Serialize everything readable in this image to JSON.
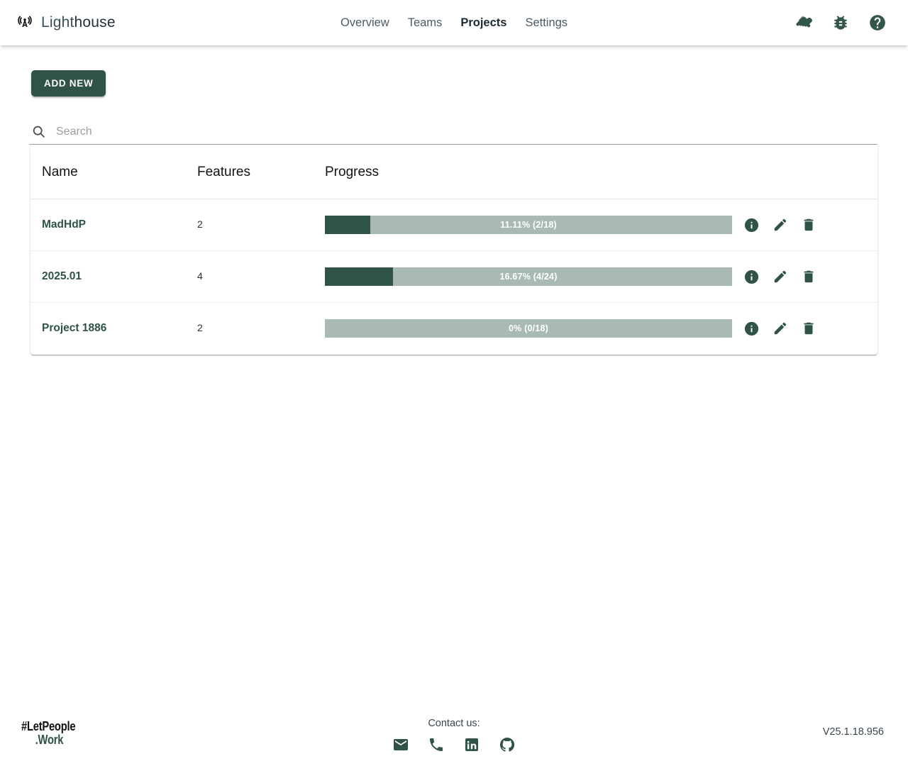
{
  "app": {
    "brand_prefix": "Light",
    "brand_suffix": "house",
    "brand_icon": "broadcast-tower-icon"
  },
  "nav": {
    "items": [
      {
        "label": "Overview",
        "active": false
      },
      {
        "label": "Teams",
        "active": false
      },
      {
        "label": "Projects",
        "active": true
      },
      {
        "label": "Settings",
        "active": false
      }
    ]
  },
  "header_actions": [
    {
      "name": "handshake-icon"
    },
    {
      "name": "bug-icon"
    },
    {
      "name": "help-circle-icon"
    }
  ],
  "toolbar": {
    "add_new_label": "ADD NEW"
  },
  "search": {
    "placeholder": "Search",
    "value": "",
    "icon": "search-icon"
  },
  "table": {
    "columns": [
      "Name",
      "Features",
      "Progress"
    ],
    "rows": [
      {
        "name": "MadHdP",
        "features": "2",
        "progress_label": "11.11% (2/18)",
        "progress_percent": 11.11,
        "completed": 2,
        "total": 18
      },
      {
        "name": "2025.01",
        "features": "4",
        "progress_label": "16.67% (4/24)",
        "progress_percent": 16.67,
        "completed": 4,
        "total": 24
      },
      {
        "name": "Project 1886",
        "features": "2",
        "progress_label": "0% (0/18)",
        "progress_percent": 0,
        "completed": 0,
        "total": 18
      }
    ],
    "row_actions": [
      {
        "name": "info-icon"
      },
      {
        "name": "edit-pencil-icon"
      },
      {
        "name": "delete-trash-icon"
      }
    ]
  },
  "footer": {
    "logo_line1": "#LetPeople",
    "logo_line2": ".Work",
    "contact_title": "Contact us:",
    "contact_icons": [
      {
        "name": "email-icon"
      },
      {
        "name": "phone-icon"
      },
      {
        "name": "linkedin-icon"
      },
      {
        "name": "github-icon"
      }
    ],
    "version": "V25.1.18.956"
  },
  "colors": {
    "accent_dark_green": "#2f5249",
    "progress_track": "#a9bab3",
    "text_primary": "#202124"
  }
}
